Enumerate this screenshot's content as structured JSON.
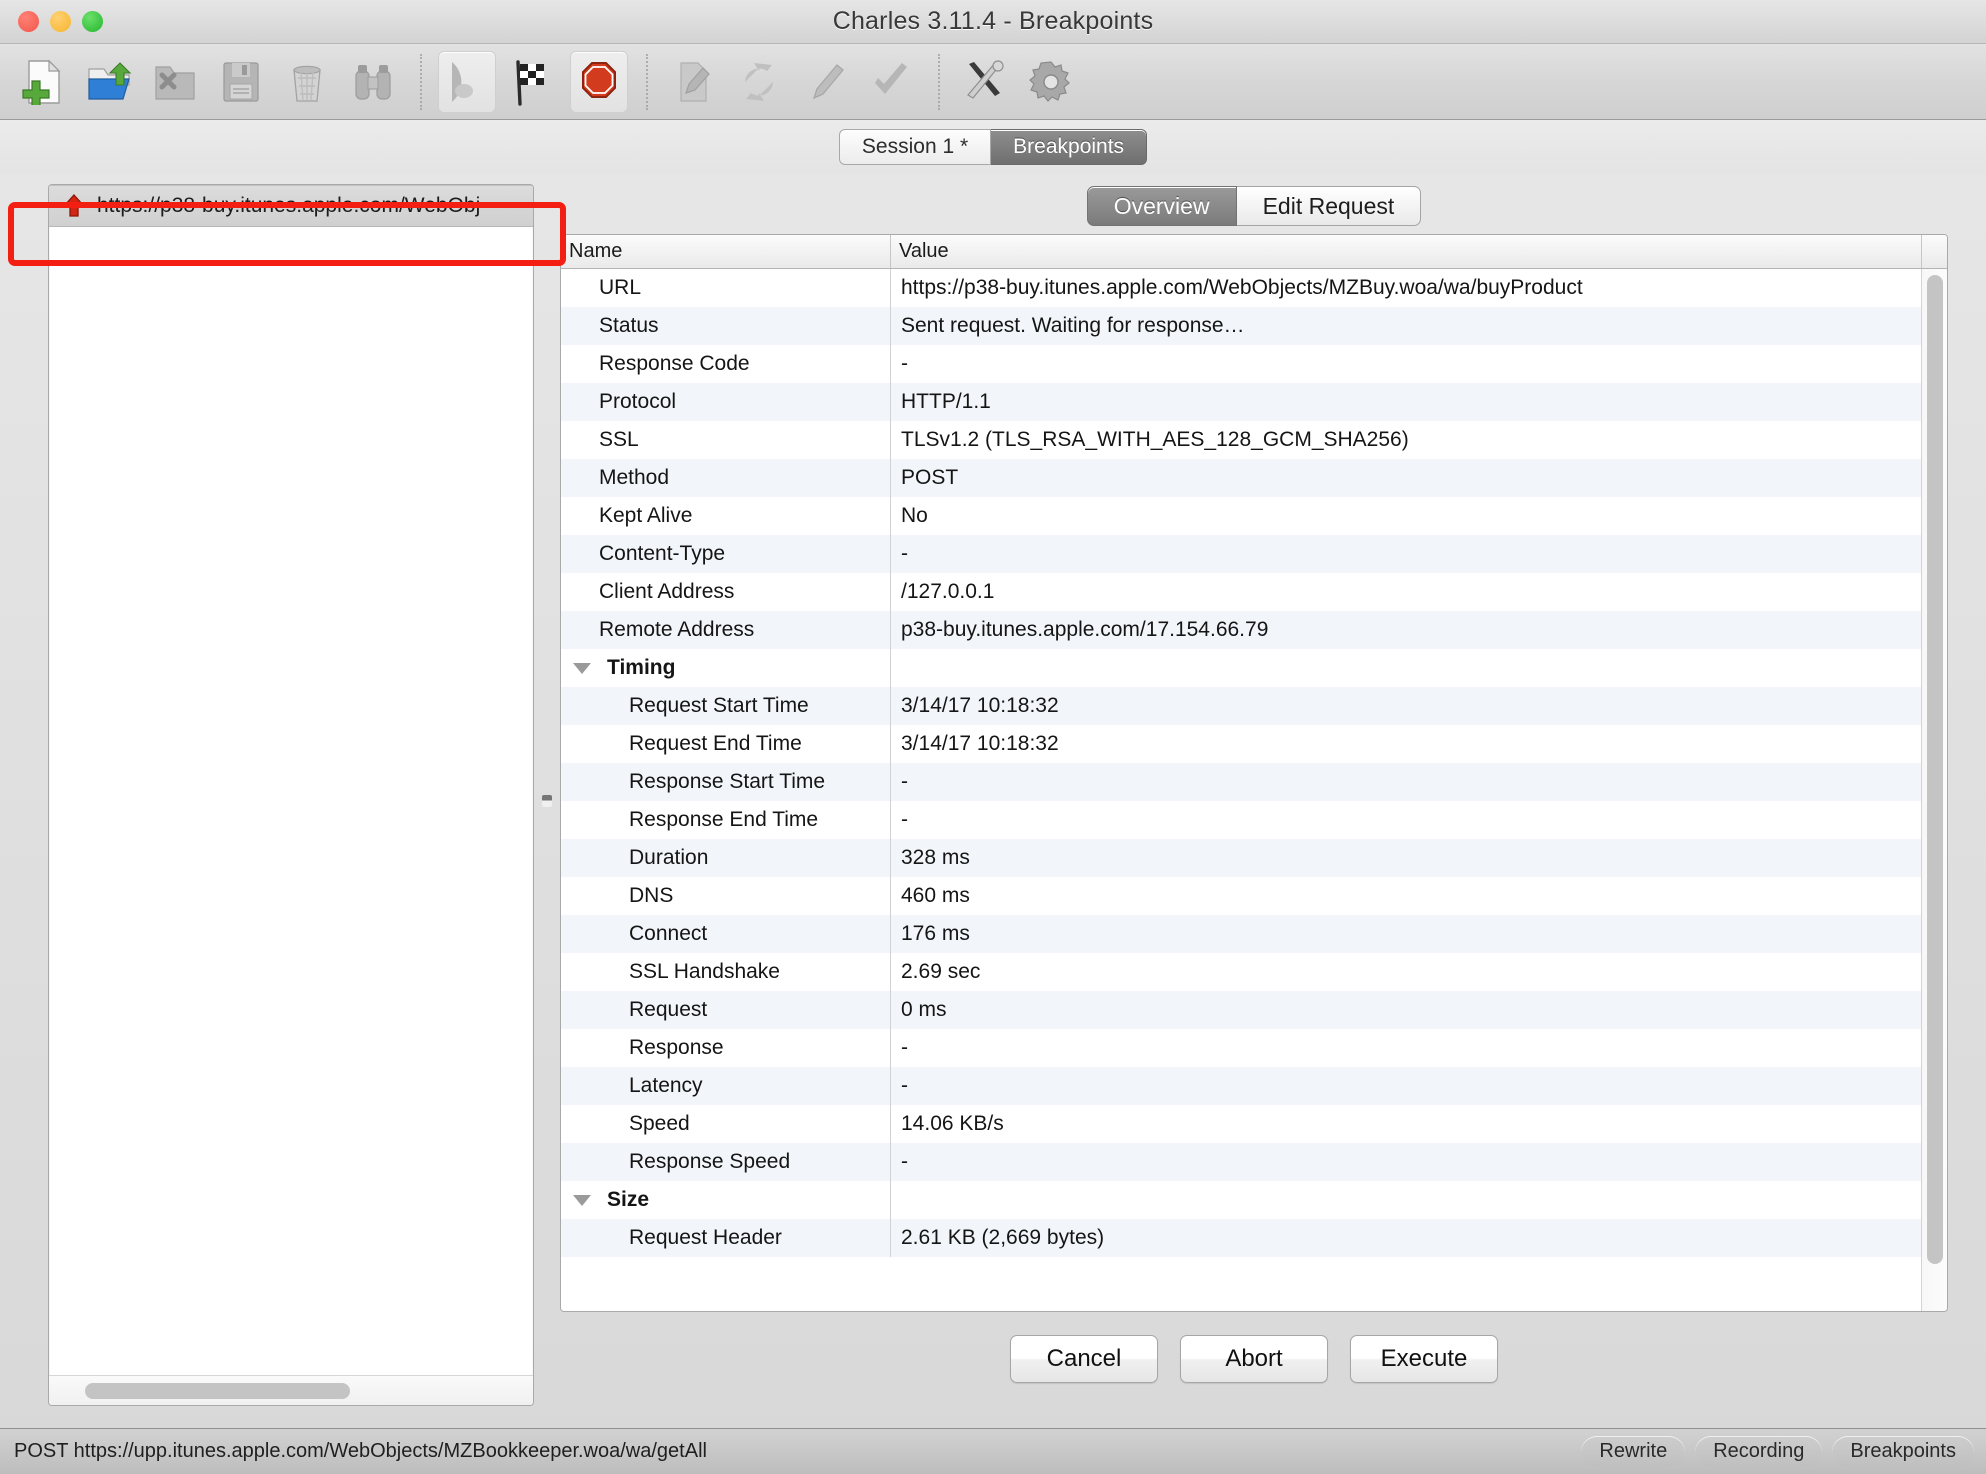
{
  "window": {
    "title": "Charles 3.11.4 - Breakpoints",
    "traffic_lights": [
      "close-button",
      "minimize-button",
      "zoom-button"
    ]
  },
  "toolbar": {
    "items": [
      {
        "name": "new-session",
        "icon": "new-document-icon",
        "selected": false
      },
      {
        "name": "open-session",
        "icon": "open-folder-icon",
        "selected": false
      },
      {
        "name": "close-session",
        "icon": "close-folder-icon",
        "selected": false
      },
      {
        "name": "save-session",
        "icon": "floppy-disk-icon",
        "selected": false
      },
      {
        "name": "clear-session",
        "icon": "trash-can-icon",
        "selected": false
      },
      {
        "name": "find",
        "icon": "binoculars-icon",
        "selected": false
      },
      {
        "name": "record",
        "icon": "record-icon",
        "selected": true
      },
      {
        "name": "throttle",
        "icon": "checkered-flag-icon",
        "selected": false
      },
      {
        "name": "breakpoints",
        "icon": "stop-sign-icon",
        "selected": true
      },
      {
        "name": "compose",
        "icon": "pencil-document-icon",
        "selected": false
      },
      {
        "name": "repeat",
        "icon": "repeat-arrows-icon",
        "selected": false
      },
      {
        "name": "edit",
        "icon": "pen-icon",
        "selected": false
      },
      {
        "name": "validate",
        "icon": "checkmark-icon",
        "selected": false
      },
      {
        "name": "tools",
        "icon": "tools-icon",
        "selected": false
      },
      {
        "name": "settings",
        "icon": "gear-icon",
        "selected": false
      }
    ]
  },
  "session_tabs": [
    {
      "label": "Session 1 *",
      "active": false
    },
    {
      "label": "Breakpoints",
      "active": true
    }
  ],
  "left_panel": {
    "entries": [
      {
        "label": "https://p38-buy.itunes.apple.com/WebObj",
        "icon": "red-up-arrow-icon"
      }
    ],
    "horizontal_scrollbar": "h-scrollbar"
  },
  "detail_tabs": [
    {
      "label": "Overview",
      "active": true
    },
    {
      "label": "Edit Request",
      "active": false
    }
  ],
  "table": {
    "columns": [
      "Name",
      "Value"
    ],
    "rows": [
      {
        "name": "URL",
        "value": "https://p38-buy.itunes.apple.com/WebObjects/MZBuy.woa/wa/buyProduct",
        "level": 1
      },
      {
        "name": "Status",
        "value": "Sent request. Waiting for response…",
        "level": 1
      },
      {
        "name": "Response Code",
        "value": "-",
        "level": 1
      },
      {
        "name": "Protocol",
        "value": "HTTP/1.1",
        "level": 1
      },
      {
        "name": "SSL",
        "value": "TLSv1.2 (TLS_RSA_WITH_AES_128_GCM_SHA256)",
        "level": 1
      },
      {
        "name": "Method",
        "value": "POST",
        "level": 1
      },
      {
        "name": "Kept Alive",
        "value": "No",
        "level": 1
      },
      {
        "name": "Content-Type",
        "value": "-",
        "level": 1
      },
      {
        "name": "Client Address",
        "value": "/127.0.0.1",
        "level": 1
      },
      {
        "name": "Remote Address",
        "value": "p38-buy.itunes.apple.com/17.154.66.79",
        "level": 1
      },
      {
        "name": "Timing",
        "value": "",
        "level": 0,
        "group": true
      },
      {
        "name": "Request Start Time",
        "value": "3/14/17 10:18:32",
        "level": 2
      },
      {
        "name": "Request End Time",
        "value": "3/14/17 10:18:32",
        "level": 2
      },
      {
        "name": "Response Start Time",
        "value": "-",
        "level": 2
      },
      {
        "name": "Response End Time",
        "value": "-",
        "level": 2
      },
      {
        "name": "Duration",
        "value": "328 ms",
        "level": 2
      },
      {
        "name": "DNS",
        "value": "460 ms",
        "level": 2
      },
      {
        "name": "Connect",
        "value": "176 ms",
        "level": 2
      },
      {
        "name": "SSL Handshake",
        "value": "2.69 sec",
        "level": 2
      },
      {
        "name": "Request",
        "value": "0 ms",
        "level": 2
      },
      {
        "name": "Response",
        "value": "-",
        "level": 2
      },
      {
        "name": "Latency",
        "value": "-",
        "level": 2
      },
      {
        "name": "Speed",
        "value": "14.06 KB/s",
        "level": 2
      },
      {
        "name": "Response Speed",
        "value": "-",
        "level": 2
      },
      {
        "name": "Size",
        "value": "",
        "level": 0,
        "group": true
      },
      {
        "name": "Request Header",
        "value": "2.61 KB (2,669 bytes)",
        "level": 2
      }
    ]
  },
  "actions": [
    {
      "label": "Cancel"
    },
    {
      "label": "Abort"
    },
    {
      "label": "Execute"
    }
  ],
  "statusbar": {
    "message": "POST https://upp.itunes.apple.com/WebObjects/MZBookkeeper.woa/wa/getAll",
    "pills": [
      "Rewrite",
      "Recording",
      "Breakpoints"
    ]
  },
  "colors": {
    "annotation_red": "#f41f13",
    "record_red": "#cc2200",
    "row_alt": "#f2f5f9",
    "accent_selected": "#7b7b7b"
  }
}
